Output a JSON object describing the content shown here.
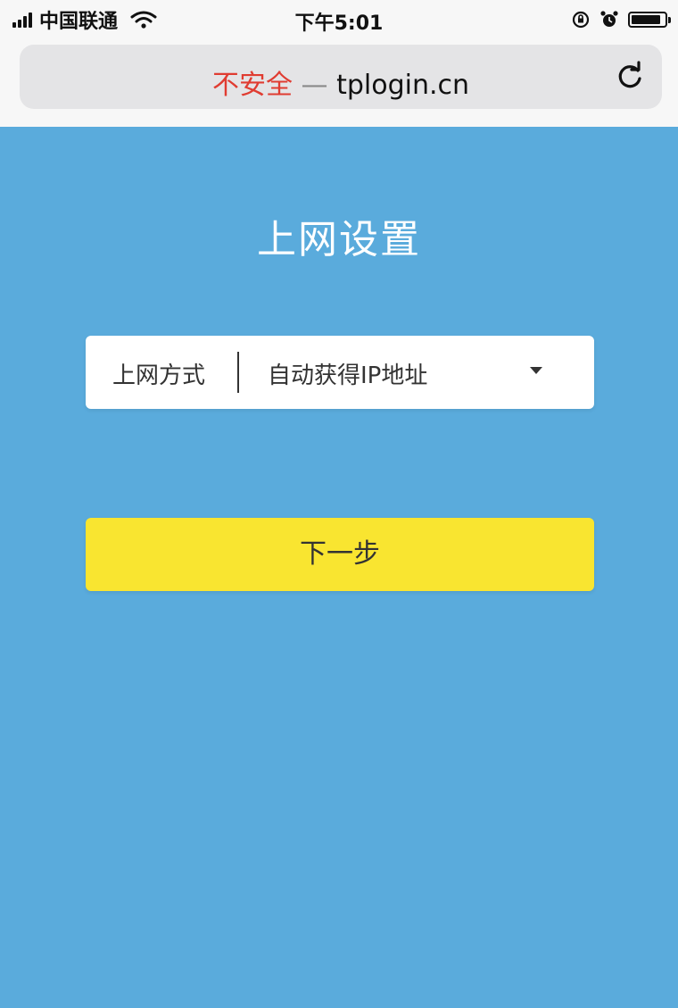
{
  "status_bar": {
    "carrier": "中国联通",
    "time": "下午5:01",
    "icons": [
      "signal-icon",
      "wifi-icon",
      "orientation-lock-icon",
      "alarm-icon",
      "battery-icon"
    ]
  },
  "browser": {
    "insecure_label": "不安全",
    "separator": "—",
    "domain": "tplogin.cn",
    "reload_icon": "reload-icon"
  },
  "page": {
    "title": "上网设置",
    "connection_type": {
      "label": "上网方式",
      "selected": "自动获得IP地址",
      "icon": "dropdown-arrow-icon"
    },
    "next_button": "下一步"
  },
  "colors": {
    "background": "#5aabdc",
    "button": "#f9e530",
    "insecure": "#e03c31"
  }
}
